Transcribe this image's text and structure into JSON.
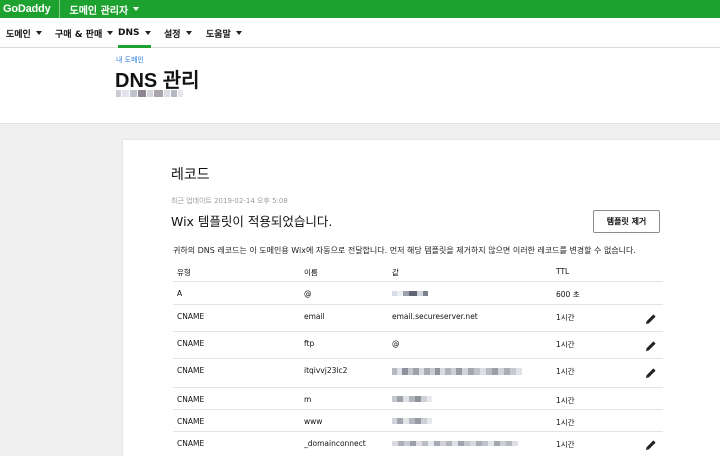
{
  "brand": {
    "logo": "GoDaddy",
    "product": "도메인 관리자",
    "accent": "#1ea22f"
  },
  "nav": [
    {
      "label": "도메인",
      "has_dropdown": true,
      "active": false
    },
    {
      "label": "구매 & 판매",
      "has_dropdown": true,
      "active": false
    },
    {
      "label": "DNS",
      "has_dropdown": true,
      "active": true
    },
    {
      "label": "설정",
      "has_dropdown": true,
      "active": false
    },
    {
      "label": "도움말",
      "has_dropdown": true,
      "active": false
    }
  ],
  "header": {
    "breadcrumb": "내 도메인",
    "title": "DNS 관리"
  },
  "records": {
    "title": "레코드",
    "updated": "최근 업데이트 2019-02-14 오후 5:08",
    "applied_message": "Wix 템플릿이 적용되었습니다.",
    "remove_template_button": "템플릿 제거",
    "description": "귀하의 DNS 레코드는 이 도메인용 Wix에 자동으로 전달합니다. 먼저 해당 템플릿을 제거하지 않으면 이러한 레코드를 변경할 수 없습니다.",
    "columns": [
      "유형",
      "이름",
      "값",
      "TTL"
    ],
    "rows": [
      {
        "type": "A",
        "name": "@",
        "value": "",
        "ttl": "600 초",
        "editable": false
      },
      {
        "type": "CNAME",
        "name": "email",
        "value": "email.secureserver.net",
        "ttl": "1시간",
        "editable": true
      },
      {
        "type": "CNAME",
        "name": "ftp",
        "value": "@",
        "ttl": "1시간",
        "editable": true
      },
      {
        "type": "CNAME",
        "name": "itqivvj23lc2",
        "value": "",
        "ttl": "1시간",
        "editable": true
      },
      {
        "type": "CNAME",
        "name": "m",
        "value": "",
        "ttl": "1시간",
        "editable": false
      },
      {
        "type": "CNAME",
        "name": "www",
        "value": "",
        "ttl": "1시간",
        "editable": false
      },
      {
        "type": "CNAME",
        "name": "_domainconnect",
        "value": "",
        "ttl": "1시간",
        "editable": true
      }
    ]
  }
}
